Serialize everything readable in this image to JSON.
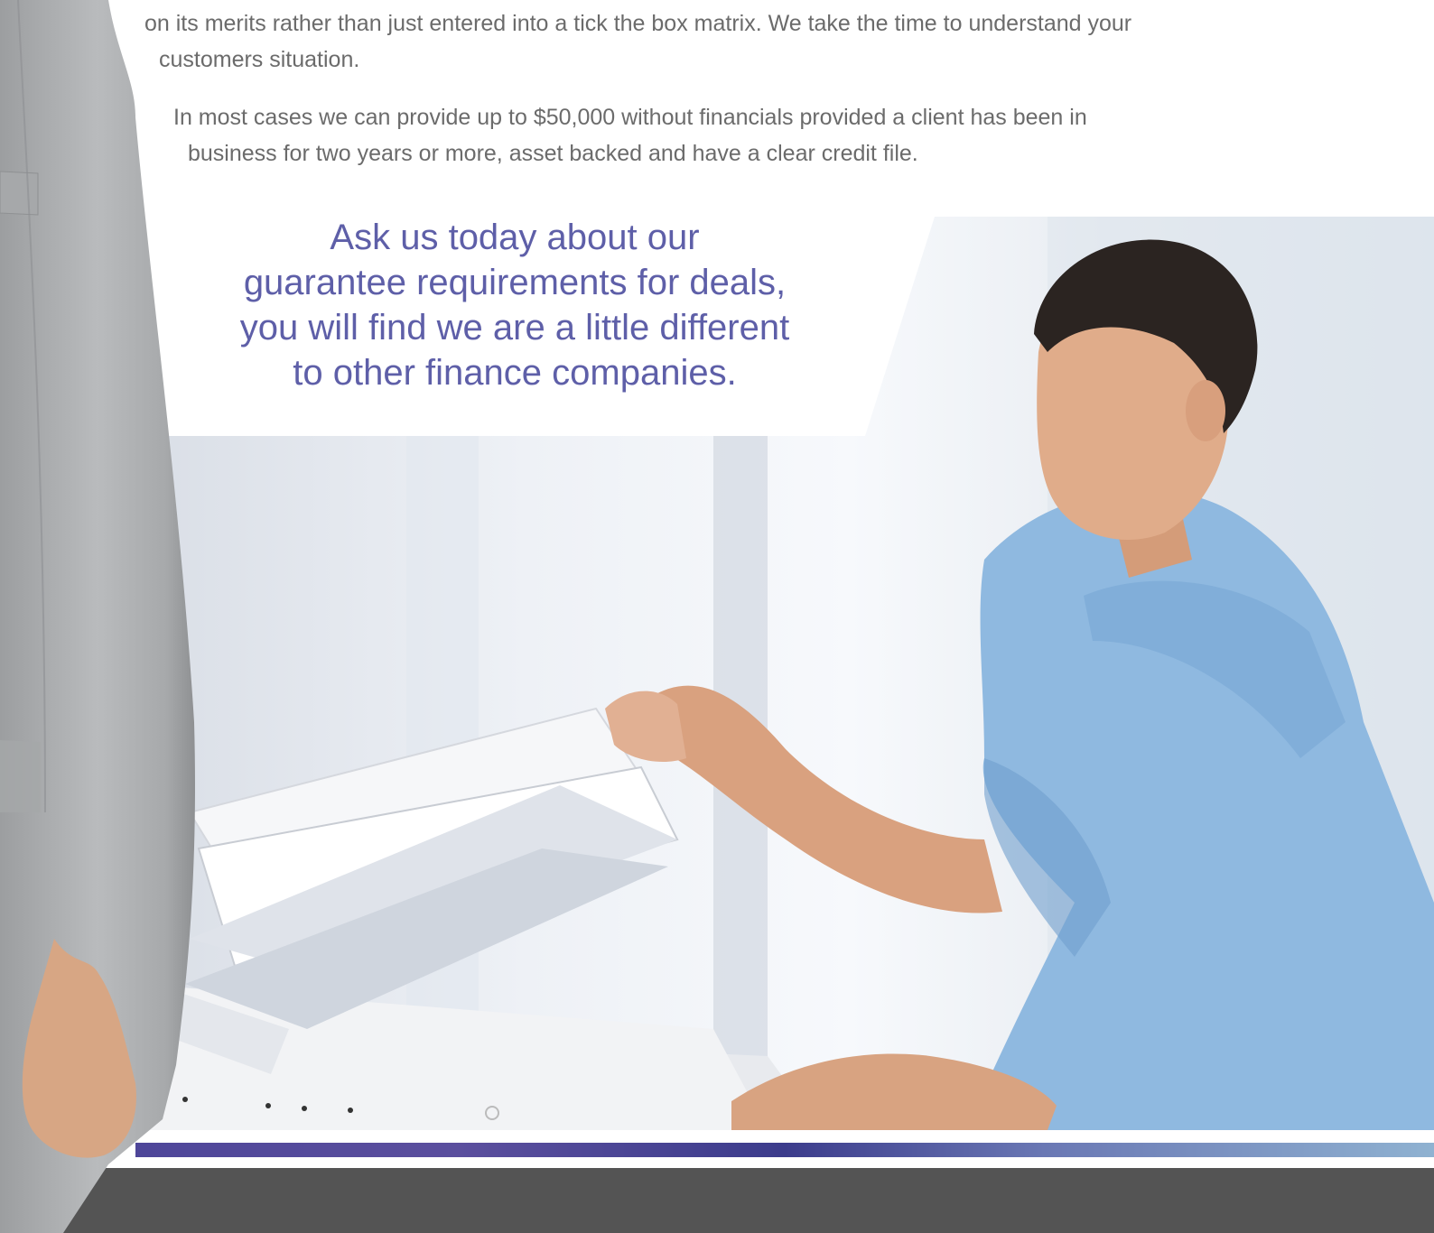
{
  "body": {
    "paragraph1_fragment": "on its merits rather than just entered into a tick the box matrix. We take the time to understand your",
    "paragraph1_end": "customers situation.",
    "paragraph2_line1": "In most cases we can provide up to $50,000 without financials provided a client has been in",
    "paragraph2_line2": "business for two years or more, asset backed and have a clear credit file."
  },
  "callout": {
    "line1": "Ask us today about our",
    "line2": "guarantee requirements for deals,",
    "line3": "you will find we are a little different",
    "line4": "to other finance companies."
  },
  "colors": {
    "body_text": "#6b6b6b",
    "callout_text": "#5e5fa8",
    "accent_bar_start": "#4e4699",
    "accent_bar_end": "#8fb2d1",
    "footer": "#545454"
  },
  "images": {
    "main_photo": "man-using-photocopier",
    "left_figure": "person-in-grey-suit"
  }
}
